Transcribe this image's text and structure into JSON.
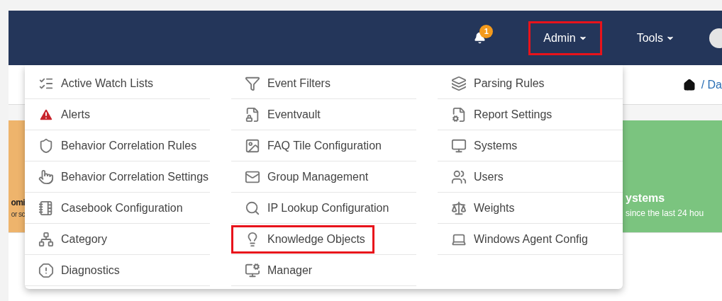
{
  "navbar": {
    "notifications": {
      "count": "1"
    },
    "items": [
      {
        "label": "Admin",
        "highlighted": true
      },
      {
        "label": "Tools",
        "highlighted": false
      }
    ]
  },
  "breadcrumb": {
    "text": "/ Da"
  },
  "tiles": [
    {
      "title": "omi",
      "subtitle": "or sc",
      "color": "#eeb46c"
    },
    {
      "title": "ystems",
      "subtitle": "since the last 24 hou",
      "color": "#7bc47f"
    }
  ],
  "admin_menu": {
    "columns": [
      [
        {
          "label": "Active Watch Lists",
          "highlighted": false
        },
        {
          "label": "Alerts",
          "highlighted": false
        },
        {
          "label": "Behavior Correlation Rules",
          "highlighted": false
        },
        {
          "label": "Behavior Correlation Settings",
          "highlighted": false
        },
        {
          "label": "Casebook Configuration",
          "highlighted": false
        },
        {
          "label": "Category",
          "highlighted": false
        },
        {
          "label": "Diagnostics",
          "highlighted": false
        }
      ],
      [
        {
          "label": "Event Filters",
          "highlighted": false
        },
        {
          "label": "Eventvault",
          "highlighted": false
        },
        {
          "label": "FAQ Tile Configuration",
          "highlighted": false
        },
        {
          "label": "Group Management",
          "highlighted": false
        },
        {
          "label": "IP Lookup Configuration",
          "highlighted": false
        },
        {
          "label": "Knowledge Objects",
          "highlighted": true
        },
        {
          "label": "Manager",
          "highlighted": false
        }
      ],
      [
        {
          "label": "Parsing Rules",
          "highlighted": false
        },
        {
          "label": "Report Settings",
          "highlighted": false
        },
        {
          "label": "Systems",
          "highlighted": false
        },
        {
          "label": "Users",
          "highlighted": false
        },
        {
          "label": "Weights",
          "highlighted": false
        },
        {
          "label": "Windows Agent Config",
          "highlighted": false
        }
      ]
    ]
  }
}
